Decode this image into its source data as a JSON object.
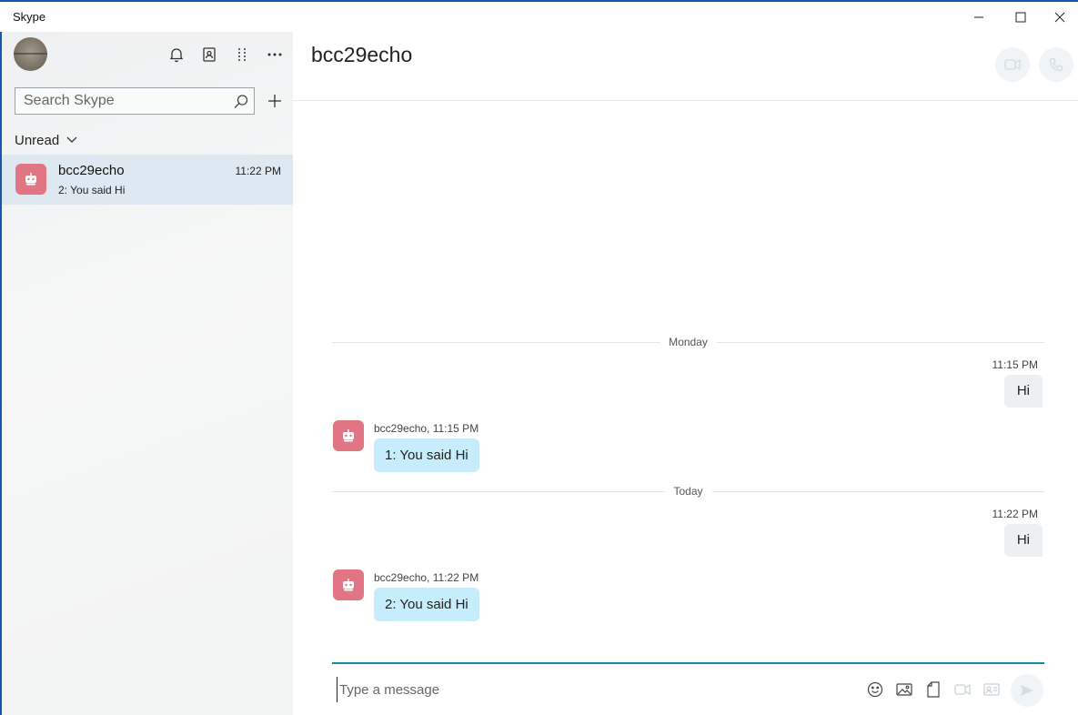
{
  "window": {
    "title": "Skype"
  },
  "sidebar": {
    "search_placeholder": "Search Skype",
    "filter_label": "Unread",
    "conversations": [
      {
        "name": "bcc29echo",
        "time": "11:22 PM",
        "preview": "2: You said Hi"
      }
    ]
  },
  "chat": {
    "title": "bcc29echo",
    "days": [
      {
        "label": "Monday",
        "outgoing": {
          "time": "11:15 PM",
          "text": "Hi"
        },
        "incoming": {
          "meta": "bcc29echo, 11:15 PM",
          "text": "1: You said Hi"
        }
      },
      {
        "label": "Today",
        "outgoing": {
          "time": "11:22 PM",
          "text": "Hi"
        },
        "incoming": {
          "meta": "bcc29echo, 11:22 PM",
          "text": "2: You said Hi"
        }
      }
    ],
    "composer_placeholder": "Type a message"
  },
  "colors": {
    "accent": "#0a8ea0",
    "bot_avatar": "#e27584",
    "incoming_bubble": "#c7ecfb",
    "outgoing_bubble": "#ecf0f2",
    "selected_conversation": "#dde8f0"
  },
  "icons": [
    "bell-icon",
    "contacts-icon",
    "dialpad-icon",
    "more-icon",
    "search-icon",
    "plus-icon",
    "chevron-down-icon",
    "bot-icon",
    "video-call-icon",
    "phone-icon",
    "emoji-icon",
    "image-icon",
    "file-icon",
    "video-message-icon",
    "contact-card-icon",
    "send-icon"
  ]
}
